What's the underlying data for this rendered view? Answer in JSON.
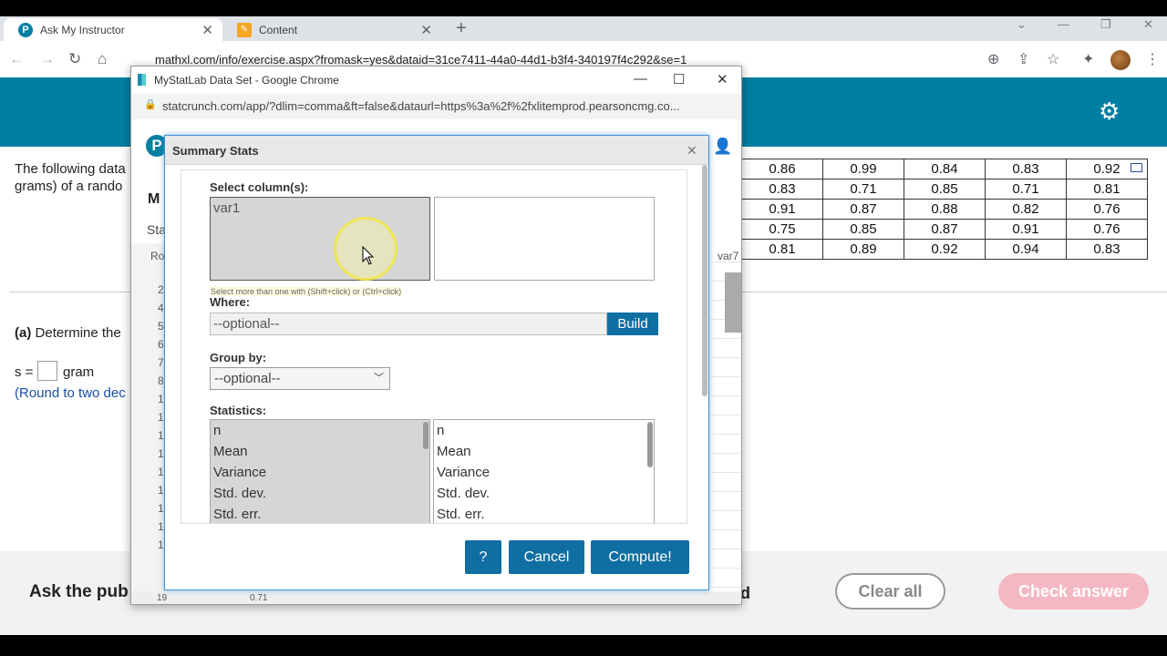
{
  "browser": {
    "tabs": [
      {
        "title": "Ask My Instructor",
        "close": "✕"
      },
      {
        "title": "Content",
        "close": "✕"
      }
    ],
    "new_tab": "+",
    "url": "mathxl.com/info/exercise.aspx?fromask=yes&dataid=31ce7411-44a0-44d1-b3f4-340197f4c292&se=1"
  },
  "page": {
    "question_line1": "The following data",
    "question_line2": "grams) of a rando",
    "part_a_label": "(a)",
    "part_a_text": "Determine the",
    "s_label": "s =",
    "unit": "gram",
    "round_note": "(Round to two dec",
    "footer_left": "Ask the pub",
    "footer_mid": "d",
    "clear_all": "Clear all",
    "check_answer": "Check answer",
    "table": [
      [
        "0.86",
        "0.99",
        "0.84",
        "0.83",
        "0.92"
      ],
      [
        "0.83",
        "0.71",
        "0.85",
        "0.71",
        "0.81"
      ],
      [
        "0.91",
        "0.87",
        "0.88",
        "0.82",
        "0.76"
      ],
      [
        "0.75",
        "0.85",
        "0.87",
        "0.91",
        "0.76"
      ],
      [
        "0.81",
        "0.89",
        "0.92",
        "0.94",
        "0.83"
      ]
    ]
  },
  "popup": {
    "window_title": "MyStatLab Data Set - Google Chrome",
    "url": "statcrunch.com/app/?dlim=comma&ft=false&dataurl=https%3a%2f%2fxlitemprod.pearsoncmg.co...",
    "logo": "P",
    "header_partial": "M",
    "sub_partial": "Sta",
    "row_header": "Ro",
    "col_header": "var7",
    "row_labels": [
      "2",
      "4",
      "5",
      "6",
      "7",
      "8",
      "1",
      "1",
      "1",
      "1",
      "1",
      "1",
      "1",
      "1",
      "1"
    ],
    "bottom_row": "19",
    "bottom_value": "0.71"
  },
  "dialog": {
    "title": "Summary Stats",
    "close": "✕",
    "select_columns_label": "Select column(s):",
    "available_columns": [
      "var1"
    ],
    "hint": "Select more than one with (Shift+click) or (Ctrl+click)",
    "where_label": "Where:",
    "where_placeholder": "--optional--",
    "build": "Build",
    "group_by_label": "Group by:",
    "group_by_value": "--optional--",
    "statistics_label": "Statistics:",
    "stats_available": [
      "n",
      "Mean",
      "Variance",
      "Std. dev.",
      "Std. err."
    ],
    "stats_selected": [
      "n",
      "Mean",
      "Variance",
      "Std. dev.",
      "Std. err."
    ],
    "help": "?",
    "cancel": "Cancel",
    "compute": "Compute!"
  }
}
